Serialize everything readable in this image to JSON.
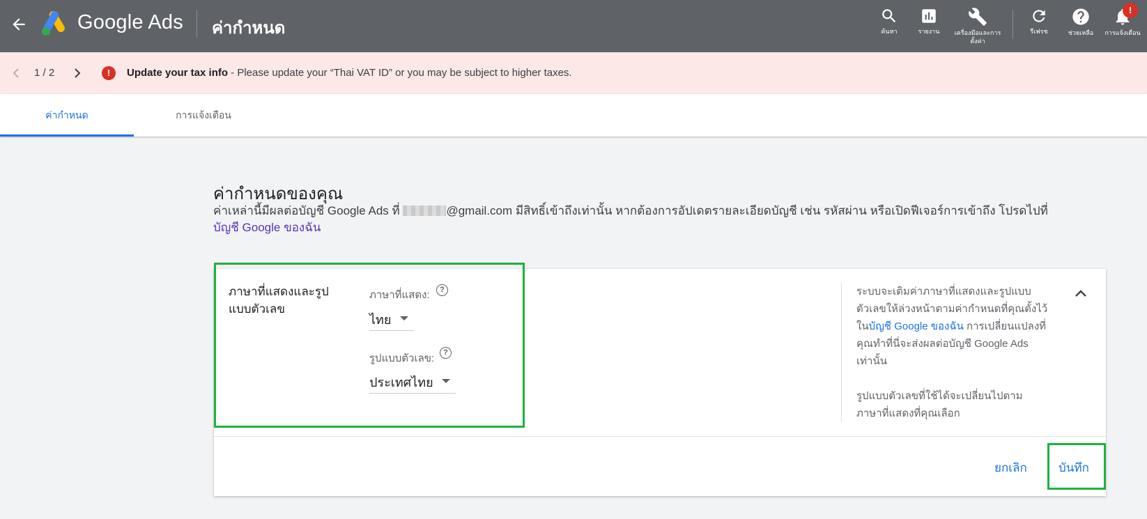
{
  "topbar": {
    "app_name": "Google Ads",
    "page_title": "ค่ากำหนด",
    "tools": [
      {
        "icon": "search-icon",
        "label": "ค้นหา"
      },
      {
        "icon": "reports-icon",
        "label": "รายงาน"
      },
      {
        "icon": "wrench-icon",
        "label": "เครื่องมือและการตั้งค่า"
      },
      {
        "icon": "refresh-icon",
        "label": "รีเฟรช"
      },
      {
        "icon": "help-icon",
        "label": "ช่วยเหลือ"
      },
      {
        "icon": "bell-icon",
        "label": "การแจ้งเตือน"
      }
    ],
    "notification_badge": "!"
  },
  "alert": {
    "pager": "1 / 2",
    "icon": "!",
    "title": "Update your tax info",
    "message": " - Please update your “Thai VAT ID” or you may be subject to higher taxes."
  },
  "tabs": [
    {
      "label": "ค่ากำหนด",
      "active": true
    },
    {
      "label": "การแจ้งเตือน",
      "active": false
    }
  ],
  "main": {
    "heading": "ค่ากำหนดของคุณ",
    "desc_before": "ค่าเหล่านี้มีผลต่อบัญชี Google Ads ที่ ",
    "desc_after": "@gmail.com มีสิทธิ์เข้าถึงเท่านั้น หากต้องการอัปเดตรายละเอียดบัญชี เช่น รหัสผ่าน หรือเปิดฟีเจอร์การเข้าถึง โปรดไปที่",
    "desc_link": "บัญชี Google ของฉัน"
  },
  "card": {
    "section_title": "ภาษาที่แสดงและรูปแบบตัวเลข",
    "language_label": "ภาษาที่แสดง:",
    "language_value": "ไทย",
    "number_format_label": "รูปแบบตัวเลข:",
    "number_format_value": "ประเทศไทย",
    "info1_a": "ระบบจะเติมค่าภาษาที่แสดงและรูปแบบตัวเลขให้ล่วงหน้าตามค่ากำหนดที่คุณตั้งไว้ใน",
    "info1_link": "บัญชี Google ของฉัน",
    "info1_b": " การเปลี่ยนแปลงที่คุณทำที่นี่จะส่งผลต่อบัญชี Google Ads เท่านั้น",
    "info2": "รูปแบบตัวเลขที่ใช้ได้จะเปลี่ยนไปตามภาษาที่แสดงที่คุณเลือก",
    "cancel_label": "ยกเลิก",
    "save_label": "บันทึก"
  },
  "colors": {
    "topbar": "#5f6368",
    "alert_bg": "#fce8e6",
    "accent": "#1a73e8",
    "highlight": "#1eb23c"
  }
}
